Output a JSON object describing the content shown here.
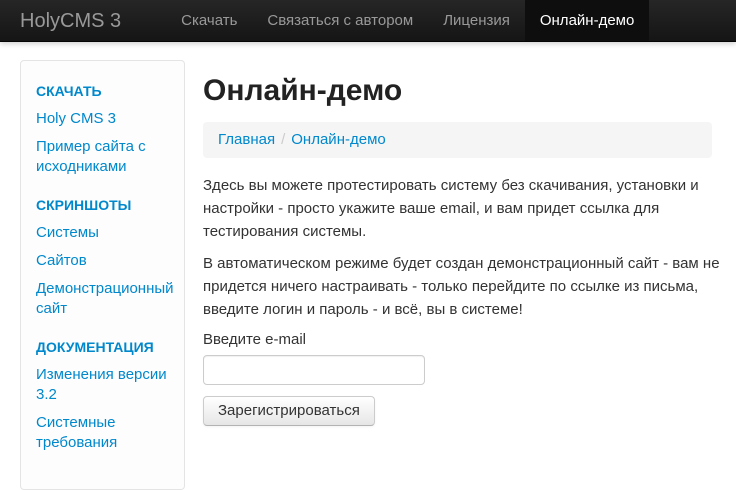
{
  "navbar": {
    "brand": "HolyCMS 3",
    "items": [
      {
        "label": "Скачать",
        "active": false
      },
      {
        "label": "Связаться с автором",
        "active": false
      },
      {
        "label": "Лицензия",
        "active": false
      },
      {
        "label": "Онлайн-демо",
        "active": true
      }
    ]
  },
  "sidebar": {
    "sections": [
      {
        "header": "СКАЧАТЬ",
        "links": [
          "Holy CMS 3",
          "Пример сайта с исходниками"
        ]
      },
      {
        "header": "СКРИНШОТЫ",
        "links": [
          "Системы",
          "Сайтов",
          "Демонстрационный сайт"
        ]
      },
      {
        "header": "ДОКУМЕНТАЦИЯ",
        "links": [
          "Изменения версии 3.2",
          "Системные требования"
        ]
      }
    ]
  },
  "main": {
    "title": "Онлайн-демо",
    "breadcrumb": {
      "items": [
        "Главная",
        "Онлайн-демо"
      ],
      "separator": "/"
    },
    "paragraphs": [
      "Здесь вы можете протестировать систему без скачивания, установки и настройки - просто укажите ваше email, и вам придет ссылка для тестирования системы.",
      "В автоматическом режиме будет создан демонстрационный сайт - вам не придется ничего настраивать - только перейдите по ссылке из письма, введите логин и пароль - и всё, вы в системе!"
    ],
    "form": {
      "label": "Введите e-mail",
      "input_value": "",
      "button": "Зарегистрироваться"
    }
  },
  "colors": {
    "navbar_bg_top": "#262626",
    "navbar_bg_bottom": "#151515",
    "navbar_active_bg": "#0e0e0e",
    "navbar_link": "#999999",
    "navbar_active_link": "#ffffff",
    "link_blue": "#0088cc",
    "text": "#333333",
    "breadcrumb_bg": "#f5f5f5",
    "input_border": "#cccccc",
    "button_bg_top": "#ffffff",
    "button_bg_bottom": "#e6e6e6"
  }
}
